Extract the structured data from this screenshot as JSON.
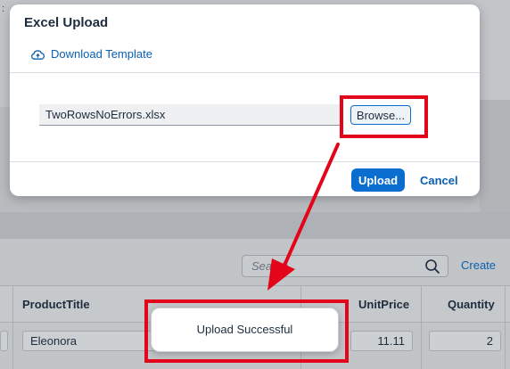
{
  "background": {
    "colon_text": ":",
    "search_placeholder": "Search",
    "create_label": "Create",
    "columns": [
      "ProductTitle",
      "UnitPrice",
      "Quantity"
    ],
    "row": {
      "product_title": "Eleonora",
      "unit_price": "11.11",
      "quantity": "2"
    }
  },
  "dialog": {
    "title": "Excel Upload",
    "download_template_label": "Download Template",
    "file_name": "TwoRowsNoErrors.xlsx",
    "browse_label": "Browse...",
    "upload_label": "Upload",
    "cancel_label": "Cancel"
  },
  "toast": {
    "message": "Upload Successful"
  },
  "colors": {
    "accent": "#0a6ed1",
    "link": "#0a5fb0",
    "annotation": "#e3051a"
  },
  "icons": {
    "download": "cloud-upload-icon",
    "search": "search-icon",
    "arrow": "annotation-arrow"
  }
}
